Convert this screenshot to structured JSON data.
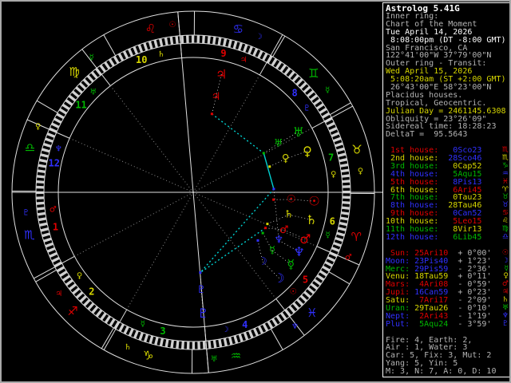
{
  "window": {
    "title": "Astrolog 5.41G"
  },
  "palette": {
    "red": "#e00000",
    "yellow": "#d6d600",
    "green": "#00b800",
    "blue": "#3030ff",
    "cyan": "#00d0d0",
    "white": "#ffffff",
    "gray": "#b4b4b4",
    "dim": "#8a8a8a"
  },
  "sidebar": {
    "title": "Astrolog 5.41G",
    "info_lines": [
      {
        "text": "Inner ring:",
        "color": "gray"
      },
      {
        "text": "Chart of the Moment",
        "color": "gray"
      },
      {
        "text": "Tue April 14, 2026",
        "color": "white"
      },
      {
        "text": " 8:08:00pm (DT -8:00 GMT)",
        "color": "white"
      },
      {
        "text": "San Francisco, CA",
        "color": "gray"
      },
      {
        "text": "122°41'00\"W 37°79'00\"N",
        "color": "gray"
      },
      {
        "text": "Outer ring - Transit:",
        "color": "gray"
      },
      {
        "text": "Wed April 15, 2026",
        "color": "yellow"
      },
      {
        "text": " 5:08:20am (ST +2:00 GMT)",
        "color": "yellow"
      },
      {
        "text": " 26°43'00\"E 58°23'00\"N",
        "color": "gray"
      },
      {
        "text": "Placidus houses.",
        "color": "gray"
      },
      {
        "text": "Tropical, Geocentric.",
        "color": "gray"
      },
      {
        "text": "Julian Day = 2461145.6308",
        "color": "yellow"
      },
      {
        "text": "Obliquity = 23°26'09\"",
        "color": "gray"
      },
      {
        "text": "Sidereal time: 18:28:23",
        "color": "gray"
      },
      {
        "text": "DeltaT =  95.5643",
        "color": "gray"
      }
    ],
    "houses": [
      {
        "label": " 1st house:",
        "value": " 0Sco23",
        "glyph": "♏",
        "label_color": "red",
        "value_color": "blue"
      },
      {
        "label": " 2nd house:",
        "value": "28Sco46",
        "glyph": "♏",
        "label_color": "yellow",
        "value_color": "blue"
      },
      {
        "label": " 3rd house:",
        "value": " 0Cap52",
        "glyph": "♑",
        "label_color": "green",
        "value_color": "yellow"
      },
      {
        "label": " 4th house:",
        "value": " 5Aqu15",
        "glyph": "♒",
        "label_color": "blue",
        "value_color": "green"
      },
      {
        "label": " 5th house:",
        "value": " 8Pis13",
        "glyph": "♓",
        "label_color": "red",
        "value_color": "blue"
      },
      {
        "label": " 6th house:",
        "value": " 6Ari45",
        "glyph": "♈",
        "label_color": "yellow",
        "value_color": "red"
      },
      {
        "label": " 7th house:",
        "value": " 0Tau23",
        "glyph": "♉",
        "label_color": "green",
        "value_color": "yellow"
      },
      {
        "label": " 8th house:",
        "value": "28Tau46",
        "glyph": "♉",
        "label_color": "blue",
        "value_color": "yellow"
      },
      {
        "label": " 9th house:",
        "value": " 0Can52",
        "glyph": "♋",
        "label_color": "red",
        "value_color": "blue"
      },
      {
        "label": "10th house:",
        "value": " 5Leo15",
        "glyph": "♌",
        "label_color": "yellow",
        "value_color": "red"
      },
      {
        "label": "11th house:",
        "value": " 8Vir13",
        "glyph": "♍",
        "label_color": "green",
        "value_color": "yellow"
      },
      {
        "label": "12th house:",
        "value": " 6Lib45",
        "glyph": "♎",
        "label_color": "blue",
        "value_color": "green"
      }
    ],
    "planets": [
      {
        "label": " Sun:",
        "value": "25Ari10",
        "velocity": "+ 0°00'",
        "glyph": "☉",
        "label_color": "red",
        "value_color": "red"
      },
      {
        "label": "Moon:",
        "value": "23Pis40",
        "velocity": "+ 1°23'",
        "glyph": "☽",
        "label_color": "blue",
        "value_color": "blue"
      },
      {
        "label": "Merc:",
        "value": "29Pis59",
        "velocity": "- 2°36'",
        "glyph": "☿",
        "label_color": "green",
        "value_color": "blue"
      },
      {
        "label": "Venu:",
        "value": "18Tau59",
        "velocity": "+ 0°11'",
        "glyph": "♀",
        "label_color": "yellow",
        "value_color": "yellow"
      },
      {
        "label": "Mars:",
        "value": " 4Ari08",
        "velocity": "- 0°59'",
        "glyph": "♂",
        "label_color": "red",
        "value_color": "red"
      },
      {
        "label": "Jupi:",
        "value": "16Can59",
        "velocity": "+ 0°23'",
        "glyph": "♃",
        "label_color": "red",
        "value_color": "blue"
      },
      {
        "label": "Satu:",
        "value": " 7Ari17",
        "velocity": "- 2°09'",
        "glyph": "♄",
        "label_color": "yellow",
        "value_color": "red"
      },
      {
        "label": "Uran:",
        "value": "29Tau26",
        "velocity": "- 0°10'",
        "glyph": "♅",
        "label_color": "green",
        "value_color": "yellow"
      },
      {
        "label": "Nept:",
        "value": " 2Ari43",
        "velocity": "- 1°19'",
        "glyph": "♆",
        "label_color": "blue",
        "value_color": "red"
      },
      {
        "label": "Plut:",
        "value": " 5Aqu24",
        "velocity": "- 3°59'",
        "glyph": "♇",
        "label_color": "blue",
        "value_color": "green"
      }
    ],
    "summary_lines": [
      "Fire: 4, Earth: 2,",
      "Air : 1, Water: 3",
      "Car: 5, Fix: 3, Mut: 2",
      "Yang: 5, Yin: 5",
      "M: 3, N: 7, A: 0, D: 10"
    ]
  },
  "wheel": {
    "ascendant": 210.3833,
    "cusps": [
      210.3833,
      238.7667,
      270.8667,
      305.25,
      338.2167,
      6.75,
      30.3833,
      58.7667,
      90.8667,
      125.25,
      158.2167,
      186.75
    ],
    "house_number_colors": [
      "red",
      "yellow",
      "green",
      "blue"
    ],
    "signs": [
      {
        "name": "aries",
        "glyph": "♈",
        "color": "red",
        "ruler_glyph": "♂",
        "ruler_color": "red"
      },
      {
        "name": "taurus",
        "glyph": "♉",
        "color": "yellow",
        "ruler_glyph": "♀",
        "ruler_color": "yellow"
      },
      {
        "name": "gemini",
        "glyph": "♊",
        "color": "green",
        "ruler_glyph": "☿",
        "ruler_color": "green"
      },
      {
        "name": "cancer",
        "glyph": "♋",
        "color": "blue",
        "ruler_glyph": "☽",
        "ruler_color": "blue"
      },
      {
        "name": "leo",
        "glyph": "♌",
        "color": "red",
        "ruler_glyph": "☉",
        "ruler_color": "red"
      },
      {
        "name": "virgo",
        "glyph": "♍",
        "color": "yellow",
        "ruler_glyph": "☿",
        "ruler_color": "green"
      },
      {
        "name": "libra",
        "glyph": "♎",
        "color": "green",
        "ruler_glyph": "♀",
        "ruler_color": "yellow"
      },
      {
        "name": "scorpio",
        "glyph": "♏",
        "color": "blue",
        "ruler_glyph": "♇",
        "ruler_color": "blue"
      },
      {
        "name": "sagittarius",
        "glyph": "♐",
        "color": "red",
        "ruler_glyph": "♃",
        "ruler_color": "red"
      },
      {
        "name": "capricorn",
        "glyph": "♑",
        "color": "yellow",
        "ruler_glyph": "♄",
        "ruler_color": "yellow"
      },
      {
        "name": "aquarius",
        "glyph": "♒",
        "color": "green",
        "ruler_glyph": "♅",
        "ruler_color": "green"
      },
      {
        "name": "pisces",
        "glyph": "♓",
        "color": "blue",
        "ruler_glyph": "♆",
        "ruler_color": "blue"
      }
    ],
    "house_rulers": [
      {
        "glyph": "♂",
        "color": "red"
      },
      {
        "glyph": "♀",
        "color": "yellow"
      },
      {
        "glyph": "☿",
        "color": "green"
      },
      {
        "glyph": "☽",
        "color": "blue"
      },
      {
        "glyph": "☉",
        "color": "red"
      },
      {
        "glyph": "☿",
        "color": "green"
      },
      {
        "glyph": "♀",
        "color": "yellow"
      },
      {
        "glyph": "♇",
        "color": "blue"
      },
      {
        "glyph": "♃",
        "color": "red"
      },
      {
        "glyph": "♄",
        "color": "yellow"
      },
      {
        "glyph": "♅",
        "color": "green"
      },
      {
        "glyph": "♆",
        "color": "blue"
      }
    ],
    "planets": [
      {
        "name": "sun",
        "glyph": "☉",
        "color": "red",
        "lambda": 25.1667,
        "display_theta": -4.2
      },
      {
        "name": "moon",
        "glyph": "☽",
        "color": "blue",
        "lambda": 353.6667,
        "display_theta": -45.0
      },
      {
        "name": "mercury",
        "glyph": "☿",
        "color": "green",
        "lambda": 359.9833,
        "display_theta": -36.4
      },
      {
        "name": "venus",
        "glyph": "♀",
        "color": "yellow",
        "lambda": 48.9833,
        "display_theta": 19.9
      },
      {
        "name": "mars",
        "glyph": "♂",
        "color": "red",
        "lambda": 4.1333,
        "display_theta": -22.6
      },
      {
        "name": "jupiter",
        "glyph": "♃",
        "color": "red",
        "lambda": 106.9833,
        "display_theta": 76.6
      },
      {
        "name": "saturn",
        "glyph": "♄",
        "color": "yellow",
        "lambda": 7.2833,
        "display_theta": -13.2
      },
      {
        "name": "uranus",
        "glyph": "♅",
        "color": "green",
        "lambda": 59.4333,
        "display_theta": 29.8
      },
      {
        "name": "neptune",
        "glyph": "♆",
        "color": "blue",
        "lambda": 32.7167,
        "display_theta": -29.3
      },
      {
        "name": "pluto",
        "glyph": "♇",
        "color": "blue",
        "lambda": 305.4,
        "display_theta": -85.3
      }
    ],
    "aspects": [
      {
        "from": 5,
        "to": 7,
        "style": "dotted"
      },
      {
        "from": 7,
        "to": 8,
        "style": "solid"
      },
      {
        "from": 8,
        "to": 9,
        "style": "dotted"
      },
      {
        "from": 4,
        "to": 9,
        "style": "dotted"
      }
    ]
  }
}
